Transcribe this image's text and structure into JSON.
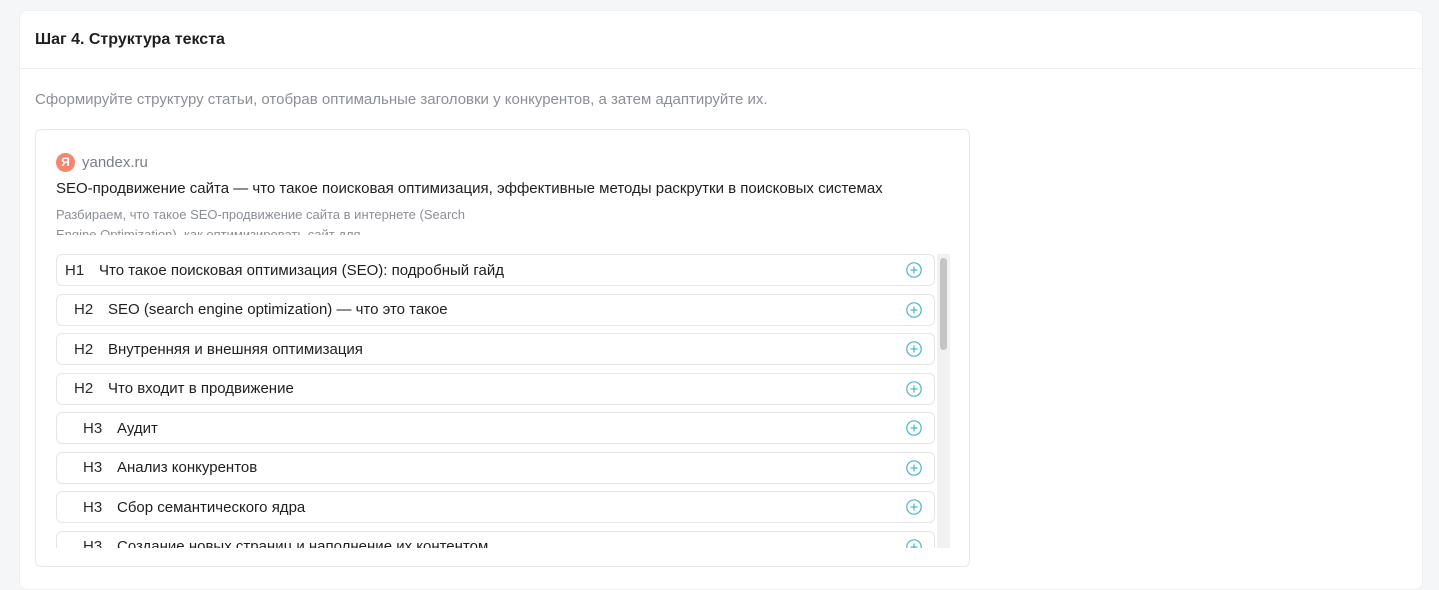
{
  "step": {
    "title": "Шаг 4. Структура текста"
  },
  "hint": "Сформируйте структуру статьи, отобрав оптимальные заголовки у конкурентов, а затем адаптируйте их.",
  "source": {
    "icon_letter": "Я",
    "domain": "yandex.ru",
    "title": "SEO-продвижение сайта — что такое поисковая оптимизация, эффективные методы раскрутки в поисковых системах",
    "snippet": "Разбираем, что такое SEO-продвижение сайта в интернете (Search Engine Optimization), как оптимизировать сайт для"
  },
  "headings": [
    {
      "level": "H1",
      "text": "Что такое поисковая оптимизация (SEO): подробный гайд"
    },
    {
      "level": "H2",
      "text": "SEO (search engine optimization) — что это такое"
    },
    {
      "level": "H2",
      "text": "Внутренняя и внешняя оптимизация"
    },
    {
      "level": "H2",
      "text": "Что входит в продвижение"
    },
    {
      "level": "H3",
      "text": "Аудит"
    },
    {
      "level": "H3",
      "text": "Анализ конкурентов"
    },
    {
      "level": "H3",
      "text": "Сбор семантического ядра"
    },
    {
      "level": "H3",
      "text": "Создание новых страниц и наполнение их контентом"
    }
  ],
  "icons": {
    "add": "plus-circle-icon",
    "brand": "yandex-icon"
  },
  "colors": {
    "accent": "#4ab3d0",
    "yandex": "#f5856f"
  }
}
